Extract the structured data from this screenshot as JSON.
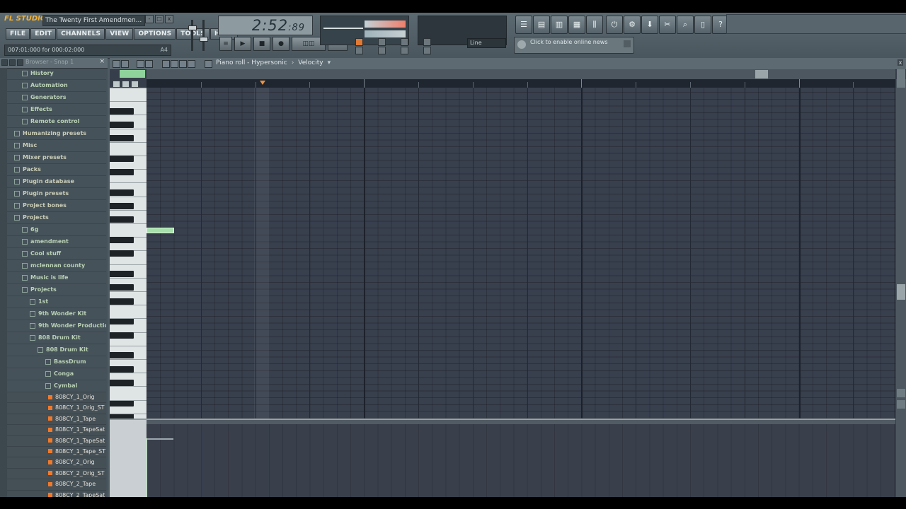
{
  "app": {
    "logo": "FL STUDIO",
    "project_title": "The Twenty First Amendmen...",
    "hint": "007:01:000 for 000:02:000",
    "hint_right": "A4"
  },
  "menu": [
    "FILE",
    "EDIT",
    "CHANNELS",
    "VIEW",
    "OPTIONS",
    "TOOLS",
    "HELP"
  ],
  "clock": {
    "main": "2:52",
    "sub": ":89"
  },
  "news": {
    "text": "Click to enable online news"
  },
  "snap": {
    "value": "Line"
  },
  "browser": {
    "title": "Browser - Snap 1",
    "items": [
      {
        "label": "History",
        "indent": 1
      },
      {
        "label": "Automation",
        "indent": 1
      },
      {
        "label": "Generators",
        "indent": 1
      },
      {
        "label": "Effects",
        "indent": 1
      },
      {
        "label": "Remote control",
        "indent": 1
      },
      {
        "label": "Humanizing presets",
        "indent": 0
      },
      {
        "label": "Misc",
        "indent": 0
      },
      {
        "label": "Mixer presets",
        "indent": 0
      },
      {
        "label": "Packs",
        "indent": 0
      },
      {
        "label": "Plugin database",
        "indent": 0
      },
      {
        "label": "Plugin presets",
        "indent": 0
      },
      {
        "label": "Project bones",
        "indent": 0
      },
      {
        "label": "Projects",
        "indent": 0
      },
      {
        "label": "6g",
        "indent": 1
      },
      {
        "label": "amendment",
        "indent": 1
      },
      {
        "label": "Cool stuff",
        "indent": 1
      },
      {
        "label": "mclennan county",
        "indent": 1
      },
      {
        "label": "Music is life",
        "indent": 1
      },
      {
        "label": "Projects",
        "indent": 1
      },
      {
        "label": "1st",
        "indent": 2
      },
      {
        "label": "9th Wonder Kit",
        "indent": 2
      },
      {
        "label": "9th Wonder Production",
        "indent": 2
      },
      {
        "label": "808 Drum Kit",
        "indent": 2
      },
      {
        "label": "808 Drum Kit",
        "indent": 3
      },
      {
        "label": "BassDrum",
        "indent": 4
      },
      {
        "label": "Conga",
        "indent": 4
      },
      {
        "label": "Cymbal",
        "indent": 4
      }
    ],
    "files": [
      "808CY_1_Orig",
      "808CY_1_Orig_ST",
      "808CY_1_Tape",
      "808CY_1_TapeSat",
      "808CY_1_TapeSat",
      "808CY_1_Tape_ST",
      "808CY_2_Orig",
      "808CY_2_Orig_ST",
      "808CY_2_Tape",
      "808CY_2_TapeSat",
      "808CY_2_TapeSat",
      "808CY_2_Tape_ST"
    ]
  },
  "piano_roll": {
    "title": "Piano roll - Hypersonic",
    "arrow": "›",
    "target": "Velocity",
    "caret": "▾",
    "close": "x",
    "note_color": "#a6e0aa"
  }
}
